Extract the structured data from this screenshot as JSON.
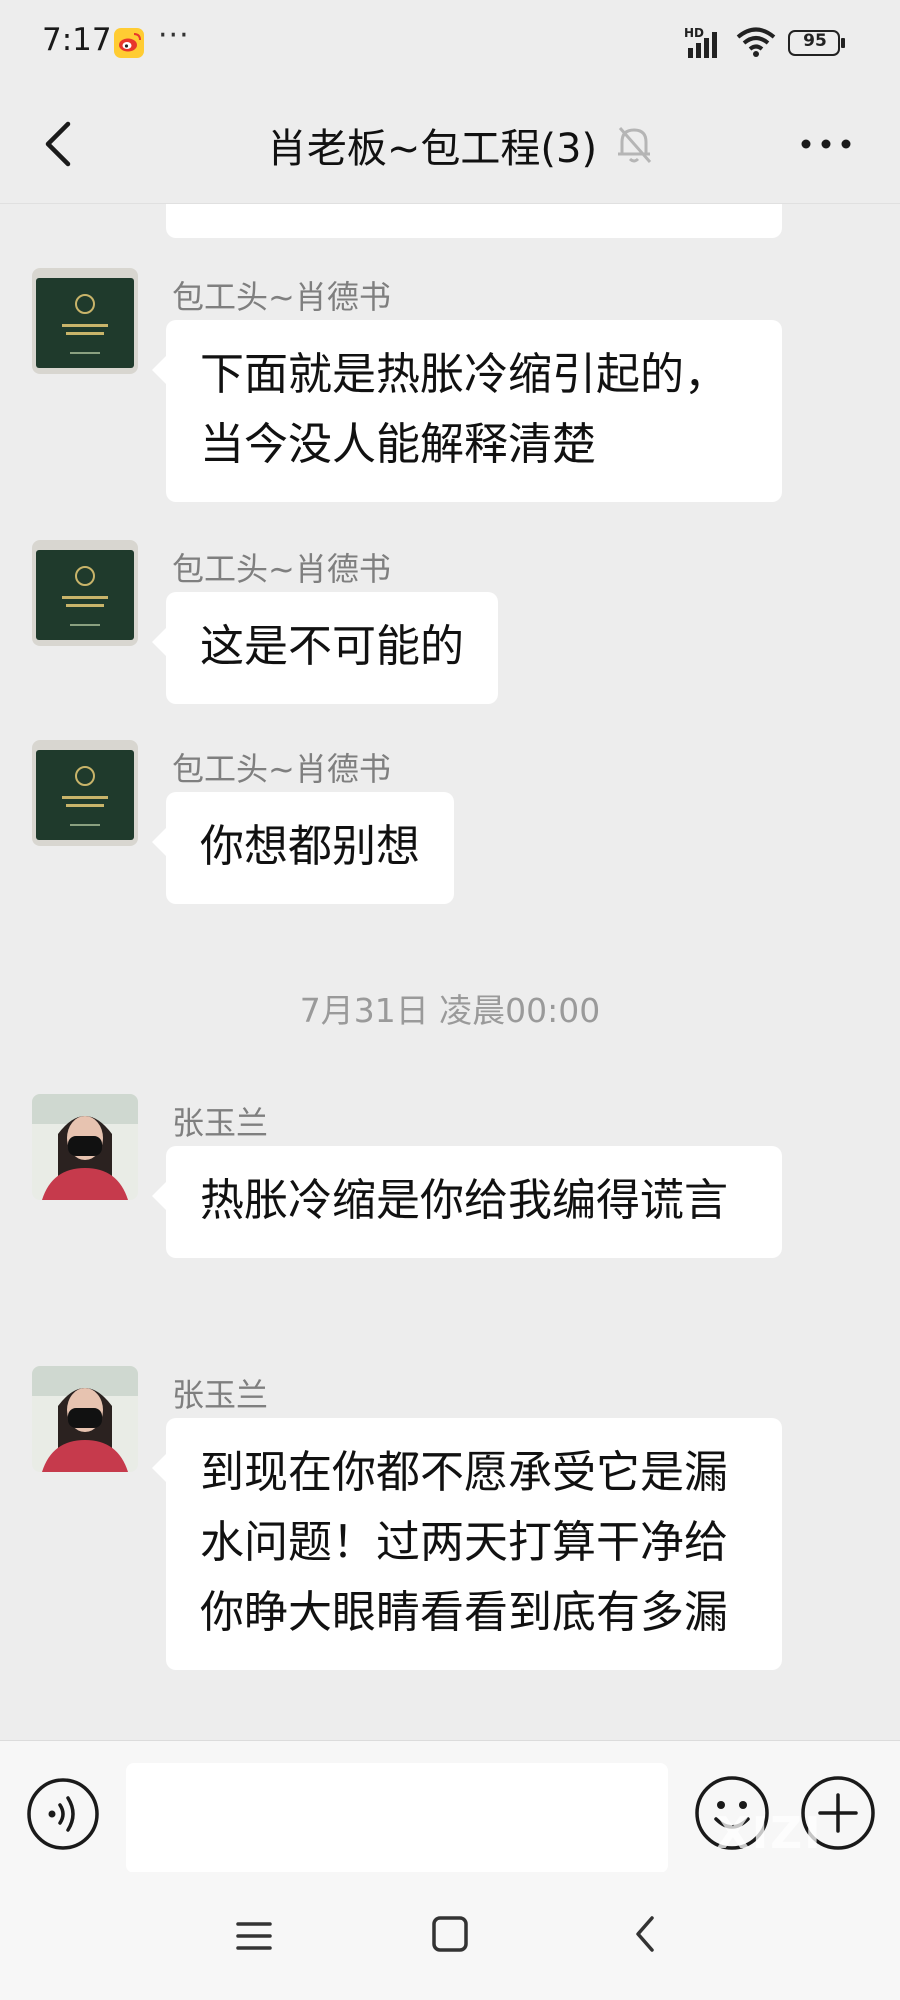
{
  "status_bar": {
    "time": "7:17",
    "dots": "···",
    "network": "HD",
    "battery": "95"
  },
  "header": {
    "title": "肖老板~包工程(3)"
  },
  "messages": [
    {
      "sender": "包工头~肖德书",
      "text": "下面就是热胀冷缩引起的，当今没人能解释清楚"
    },
    {
      "sender": "包工头~肖德书",
      "text": "这是不可能的"
    },
    {
      "sender": "包工头~肖德书",
      "text": "你想都别想"
    },
    {
      "sender": "张玉兰",
      "text": "热胀冷缩是你给我编得谎言"
    },
    {
      "sender": "张玉兰",
      "text": "到现在你都不愿承受它是漏水问题！过两天打算干净给你睁大眼睛看看到底有多漏"
    }
  ],
  "timestamp": "7月31日 凌晨00:00",
  "input": {
    "value": "",
    "placeholder": ""
  },
  "watermark": "XIZI",
  "colors": {
    "background": "#ededed",
    "bubble": "#ffffff",
    "sender_name": "#7f7f7f"
  }
}
